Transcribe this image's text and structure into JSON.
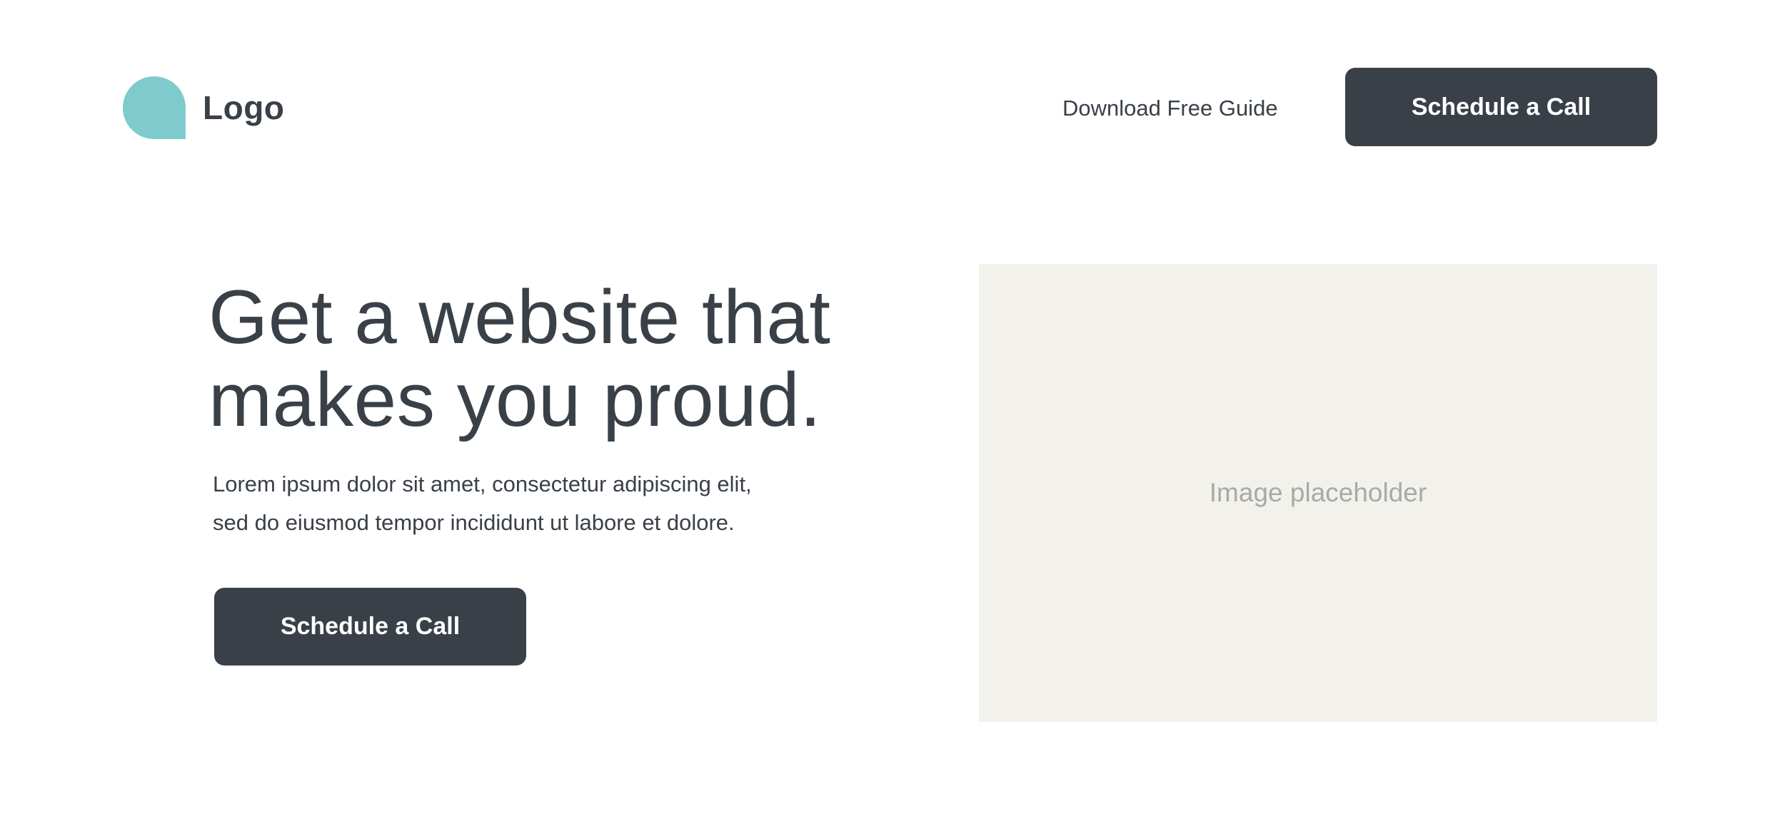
{
  "header": {
    "logo_text": "Logo",
    "nav_link": "Download Free Guide",
    "cta_label": "Schedule a Call"
  },
  "hero": {
    "title_line1": "Get a website that",
    "title_line2": "makes you proud.",
    "body_line1": "Lorem ipsum dolor sit amet, consectetur adipiscing elit,",
    "body_line2": "sed do eiusmod tempor incididunt ut labore et dolore.",
    "cta_label": "Schedule a Call",
    "image_placeholder_label": "Image placeholder"
  },
  "colors": {
    "logo_accent": "#7fcacd",
    "button_bg": "#3a4048",
    "text": "#3a4048",
    "placeholder_bg": "#f2f1ec",
    "placeholder_text": "#a9a9a6"
  }
}
